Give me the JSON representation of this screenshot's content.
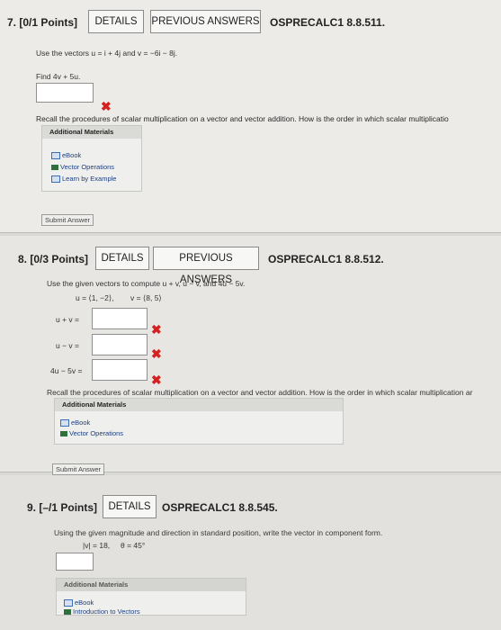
{
  "q7": {
    "header": "7.  [0/1 Points]",
    "details": "DETAILS",
    "previous": "PREVIOUS ANSWERS",
    "code": "OSPRECALC1 8.8.511.",
    "prompt": "Use the vectors  u = i + 4j  and  v = −6i − 8j.",
    "task": "Find  4v + 5u.",
    "answer": "",
    "recall": "Recall the procedures of scalar multiplication on a vector and vector addition. How is the order in which scalar multiplicatio",
    "additional": "Additional Materials",
    "resources": [
      "eBook",
      "Vector Operations",
      "Learn by Example"
    ],
    "submit": "Submit Answer"
  },
  "q8": {
    "header": "8.  [0/3 Points]",
    "details": "DETAILS",
    "previous": "PREVIOUS ANSWERS",
    "code": "OSPRECALC1 8.8.512.",
    "prompt": "Use the given vectors to compute  u + v,  u − v,  and  4u − 5v.",
    "given_u": "u = ⟨1, −2⟩,",
    "given_v": "v = ⟨8, 5⟩",
    "rows": [
      {
        "label": "u + v =",
        "value": ""
      },
      {
        "label": "u − v =",
        "value": ""
      },
      {
        "label": "4u − 5v =",
        "value": ""
      }
    ],
    "recall": "Recall the procedures of scalar multiplication on a vector and vector addition. How is the order in which scalar multiplication ar",
    "additional": "Additional Materials",
    "resources": [
      "eBook",
      "Vector Operations"
    ],
    "submit": "Submit Answer"
  },
  "q9": {
    "header": "9.  [–/1 Points]",
    "details": "DETAILS",
    "code": "OSPRECALC1 8.8.545.",
    "prompt": "Using the given magnitude and direction in standard position, write the vector in component form.",
    "given_mag": "|v| = 18,",
    "given_dir": "θ = 45°",
    "answer": "",
    "additional": "Additional Materials",
    "resources": [
      "eBook",
      "Introduction to Vectors"
    ]
  },
  "icons": {
    "incorrect": "x-mark-icon",
    "ebook": "ebook-icon",
    "document": "document-icon"
  },
  "colors": {
    "incorrect": "#d62020",
    "link": "#1d3f80"
  }
}
